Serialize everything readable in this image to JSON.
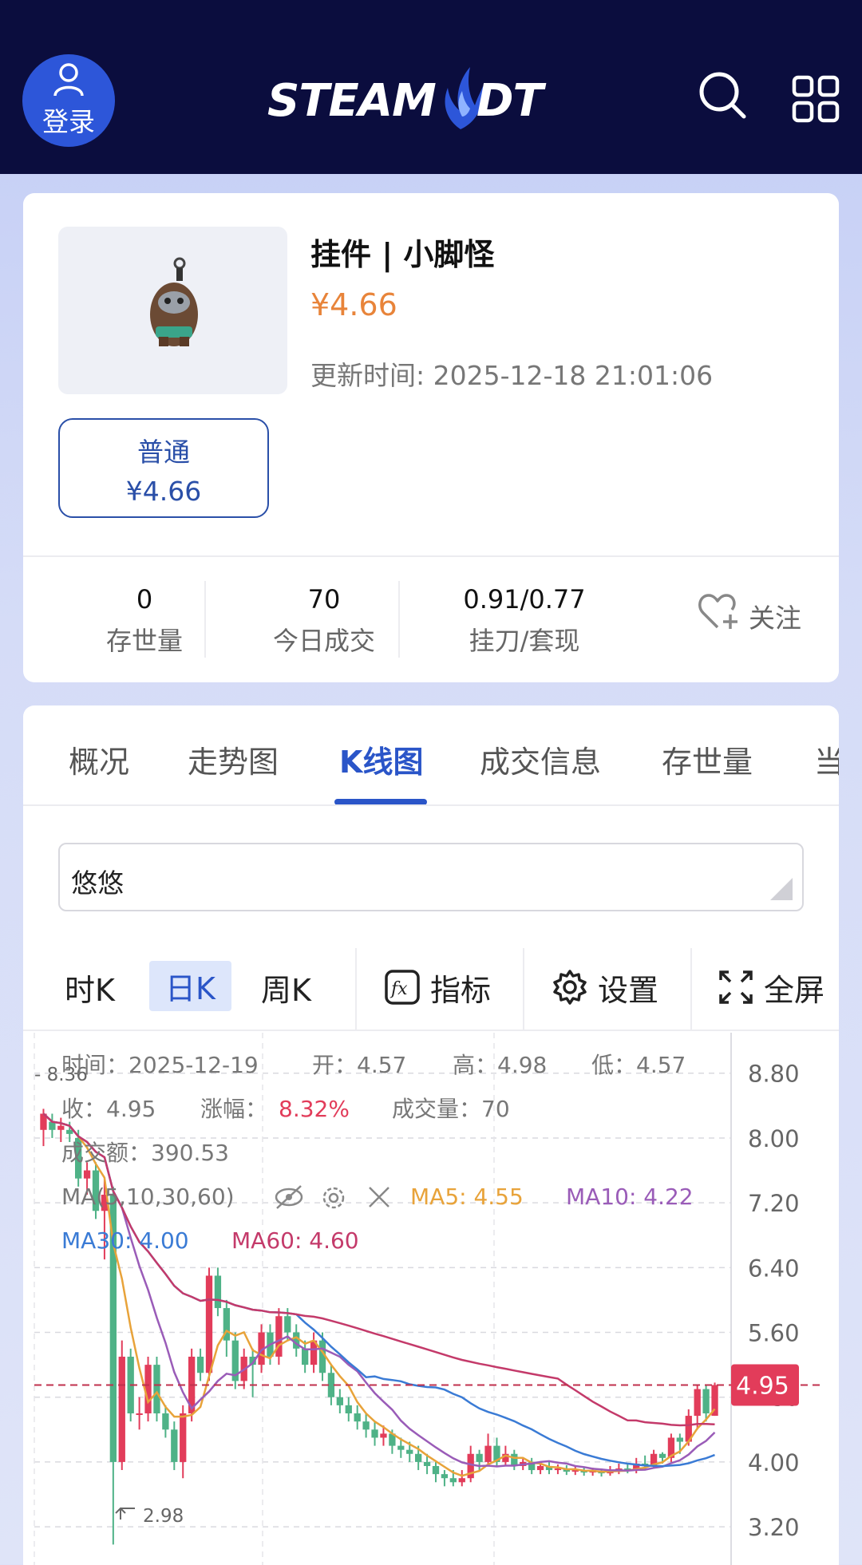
{
  "header": {
    "login_label": "登录",
    "logo_text_left": "STEAM",
    "logo_text_right": "DT"
  },
  "item": {
    "title": "挂件 | 小脚怪",
    "price": "¥4.66",
    "update_time": "更新时间: 2025-12-18 21:01:06",
    "grade_name": "普通",
    "grade_price": "¥4.66"
  },
  "stats": [
    {
      "value": "0",
      "label": "存世量"
    },
    {
      "value": "70",
      "label": "今日成交"
    },
    {
      "value": "0.91/0.77",
      "label": "挂刀/套现"
    }
  ],
  "follow_label": "关注",
  "tabs": [
    "概况",
    "走势图",
    "K线图",
    "成交信息",
    "存世量",
    "当"
  ],
  "active_tab": "K线图",
  "select": {
    "value": "悠悠"
  },
  "toolbar": {
    "hour_k": "时K",
    "day_k": "日K",
    "week_k": "周K",
    "indicators": "指标",
    "settings": "设置",
    "fullscreen": "全屏"
  },
  "info": {
    "time": "时间：2025-12-19",
    "open": "开：4.57",
    "high": "高：4.98",
    "low": "低：4.57",
    "close": "收：4.95",
    "change_label": "涨幅：",
    "change_value": "8.32%",
    "volume": "成交量：70",
    "amount": "成交额：390.53",
    "ma_params": "MA(5,10,30,60)",
    "ma5": "MA5: 4.55",
    "ma10": "MA10: 4.22",
    "ma30": "MA30: 4.00",
    "ma60": "MA60: 4.60"
  },
  "colors": {
    "accent": "#2a55c8",
    "price": "#e8843a",
    "up": "#e23c5a",
    "down": "#4fb287",
    "ma5": "#e8a33a",
    "ma10": "#9a5cb8",
    "ma30": "#3a7bd5",
    "ma60": "#c43a6a"
  },
  "chart_data": {
    "type": "candlestick",
    "y_ticks": [
      "8.80",
      "8.00",
      "7.20",
      "6.40",
      "5.60",
      "4.80",
      "4.00",
      "3.20"
    ],
    "ylim": [
      2.6,
      9.3
    ],
    "current_price": "4.95",
    "max_label": "8.36",
    "min_label": "2.98",
    "candles": [
      [
        8.1,
        8.3,
        7.9,
        8.36
      ],
      [
        8.2,
        8.1,
        8.0,
        8.3
      ],
      [
        8.1,
        8.15,
        7.95,
        8.25
      ],
      [
        8.1,
        8.05,
        7.95,
        8.2
      ],
      [
        8.0,
        7.5,
        7.4,
        8.1
      ],
      [
        7.5,
        7.6,
        7.3,
        7.7
      ],
      [
        7.6,
        7.1,
        7.0,
        7.7
      ],
      [
        7.1,
        7.3,
        6.5,
        7.5
      ],
      [
        7.3,
        4.0,
        2.98,
        7.4
      ],
      [
        4.0,
        5.3,
        3.9,
        5.5
      ],
      [
        5.3,
        4.6,
        4.5,
        5.4
      ],
      [
        4.6,
        4.6,
        4.4,
        4.8
      ],
      [
        4.6,
        5.2,
        4.5,
        5.3
      ],
      [
        5.2,
        4.6,
        4.5,
        5.3
      ],
      [
        4.6,
        4.4,
        4.3,
        4.7
      ],
      [
        4.4,
        4.0,
        3.9,
        4.5
      ],
      [
        4.0,
        4.6,
        3.8,
        4.7
      ],
      [
        4.6,
        5.3,
        4.5,
        5.4
      ],
      [
        5.3,
        5.1,
        5.0,
        5.4
      ],
      [
        5.1,
        6.3,
        5.0,
        6.4
      ],
      [
        6.3,
        5.9,
        5.8,
        6.4
      ],
      [
        5.9,
        5.5,
        5.3,
        6.0
      ],
      [
        5.5,
        5.0,
        4.9,
        5.6
      ],
      [
        5.0,
        5.3,
        4.9,
        5.4
      ],
      [
        5.3,
        5.2,
        4.8,
        5.4
      ],
      [
        5.2,
        5.6,
        5.1,
        5.7
      ],
      [
        5.6,
        5.3,
        5.2,
        5.7
      ],
      [
        5.3,
        5.8,
        5.2,
        5.9
      ],
      [
        5.8,
        5.6,
        5.5,
        5.9
      ],
      [
        5.6,
        5.4,
        5.3,
        5.7
      ],
      [
        5.4,
        5.2,
        5.1,
        5.5
      ],
      [
        5.2,
        5.5,
        5.1,
        5.6
      ],
      [
        5.5,
        5.1,
        5.0,
        5.6
      ],
      [
        5.1,
        4.8,
        4.7,
        5.2
      ],
      [
        4.8,
        4.7,
        4.6,
        4.9
      ],
      [
        4.7,
        4.6,
        4.5,
        4.8
      ],
      [
        4.6,
        4.5,
        4.4,
        4.7
      ],
      [
        4.5,
        4.4,
        4.3,
        4.6
      ],
      [
        4.4,
        4.3,
        4.2,
        4.5
      ],
      [
        4.3,
        4.35,
        4.2,
        4.45
      ],
      [
        4.35,
        4.2,
        4.1,
        4.4
      ],
      [
        4.2,
        4.15,
        4.05,
        4.3
      ],
      [
        4.15,
        4.1,
        4.0,
        4.25
      ],
      [
        4.1,
        4.0,
        3.9,
        4.2
      ],
      [
        4.0,
        3.95,
        3.85,
        4.1
      ],
      [
        3.95,
        3.85,
        3.75,
        4.0
      ],
      [
        3.85,
        3.8,
        3.7,
        3.9
      ],
      [
        3.8,
        3.75,
        3.7,
        3.9
      ],
      [
        3.75,
        3.8,
        3.7,
        3.9
      ],
      [
        3.8,
        4.1,
        3.75,
        4.2
      ],
      [
        4.1,
        4.0,
        3.9,
        4.15
      ],
      [
        4.0,
        4.2,
        3.95,
        4.35
      ],
      [
        4.2,
        4.0,
        3.95,
        4.3
      ],
      [
        4.0,
        4.1,
        3.95,
        4.2
      ],
      [
        4.1,
        3.95,
        3.9,
        4.15
      ],
      [
        3.95,
        4.0,
        3.9,
        4.05
      ],
      [
        4.0,
        3.9,
        3.85,
        4.05
      ],
      [
        3.9,
        3.95,
        3.85,
        4.0
      ],
      [
        3.95,
        3.9,
        3.85,
        4.0
      ],
      [
        3.9,
        3.92,
        3.85,
        3.97
      ],
      [
        3.92,
        3.88,
        3.84,
        3.96
      ],
      [
        3.88,
        3.9,
        3.84,
        3.95
      ],
      [
        3.9,
        3.87,
        3.83,
        3.94
      ],
      [
        3.87,
        3.89,
        3.83,
        3.93
      ],
      [
        3.89,
        3.86,
        3.82,
        3.92
      ],
      [
        3.86,
        3.9,
        3.83,
        3.95
      ],
      [
        3.9,
        3.92,
        3.85,
        3.98
      ],
      [
        3.92,
        3.9,
        3.86,
        3.97
      ],
      [
        3.9,
        3.98,
        3.86,
        4.05
      ],
      [
        3.98,
        3.95,
        3.9,
        4.08
      ],
      [
        3.95,
        4.1,
        3.92,
        4.15
      ],
      [
        4.1,
        4.05,
        3.98,
        4.12
      ],
      [
        4.05,
        4.3,
        4.0,
        4.35
      ],
      [
        4.3,
        4.25,
        4.1,
        4.35
      ],
      [
        4.25,
        4.57,
        4.2,
        4.65
      ],
      [
        4.57,
        4.9,
        4.4,
        4.95
      ],
      [
        4.9,
        4.6,
        4.5,
        4.95
      ],
      [
        4.57,
        4.95,
        4.57,
        4.98
      ]
    ]
  }
}
